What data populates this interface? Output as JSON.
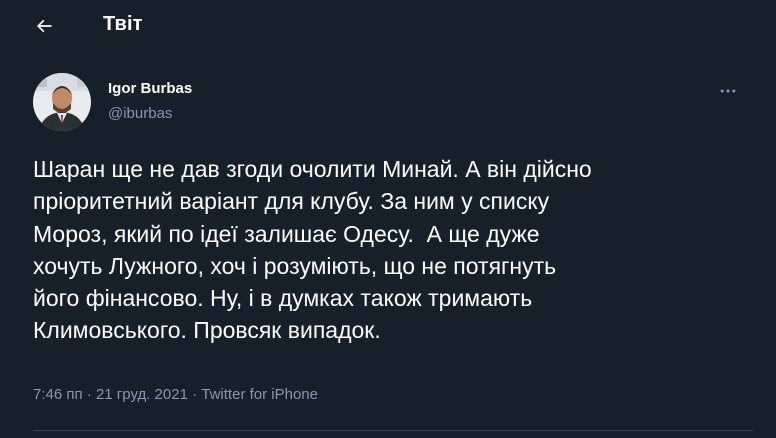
{
  "header": {
    "title": "Твіт",
    "back_icon": "arrow-left-icon"
  },
  "tweet": {
    "author": {
      "name": "Igor Burbas",
      "handle": "@iburbas",
      "avatar_icon": "avatar-photo"
    },
    "more_icon": "more-horizontal-icon",
    "text": "Шаран ще не дав згоди очолити Минай. А він дійсно\nпріоритетний варіант для клубу. За ним у списку\nМороз, який по ідеї залишає Одесу.  А ще дуже\nхочуть Лужного, хоч і розуміють, що не потягнуть\nйого фінансово. Ну, і в думках також тримають\nКлимовського. Провсяк випадок.",
    "time": "7:46 пп",
    "separator": " · ",
    "date": "21 груд. 2021",
    "source": "Twitter for iPhone"
  },
  "colors": {
    "background": "#15202b",
    "text_primary": "#ffffff",
    "text_secondary": "#8b98a5",
    "divider": "#38444d"
  }
}
